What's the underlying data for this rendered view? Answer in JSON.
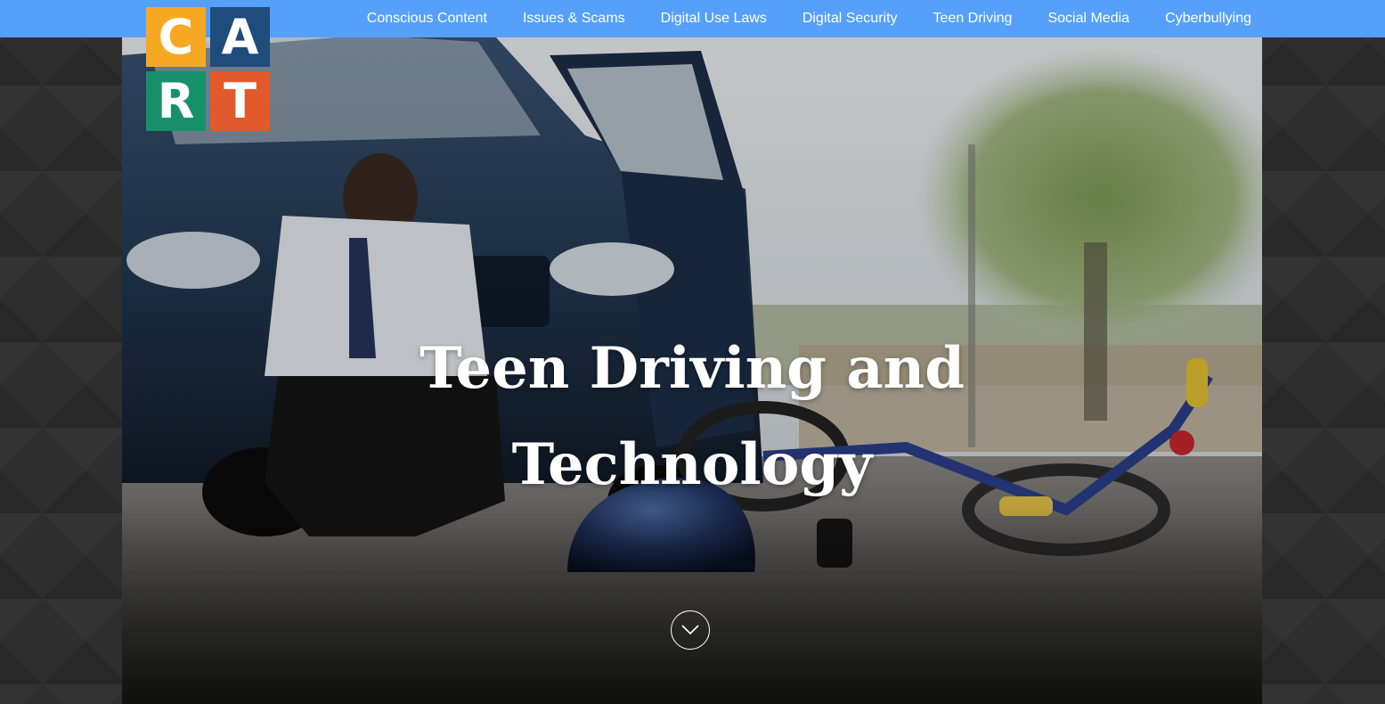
{
  "brand": {
    "logo_letters": [
      "C",
      "A",
      "R",
      "T"
    ],
    "logo_colors": [
      "#f7a823",
      "#1e4c7c",
      "#17906a",
      "#e25a2b"
    ]
  },
  "nav": {
    "items": [
      {
        "label": "Conscious Content"
      },
      {
        "label": "Issues & Scams"
      },
      {
        "label": "Digital Use Laws"
      },
      {
        "label": "Digital Security"
      },
      {
        "label": "Teen Driving"
      },
      {
        "label": "Social Media"
      },
      {
        "label": "Cyberbullying"
      }
    ]
  },
  "hero": {
    "title_line1": "Teen Driving and",
    "title_line2": "Technology",
    "scroll_icon": "chevron-down-icon"
  },
  "colors": {
    "nav_bar": "#55a0fb",
    "page_background": "#2e2e2e",
    "nav_text": "#ffffff",
    "hero_title": "#ffffff"
  }
}
